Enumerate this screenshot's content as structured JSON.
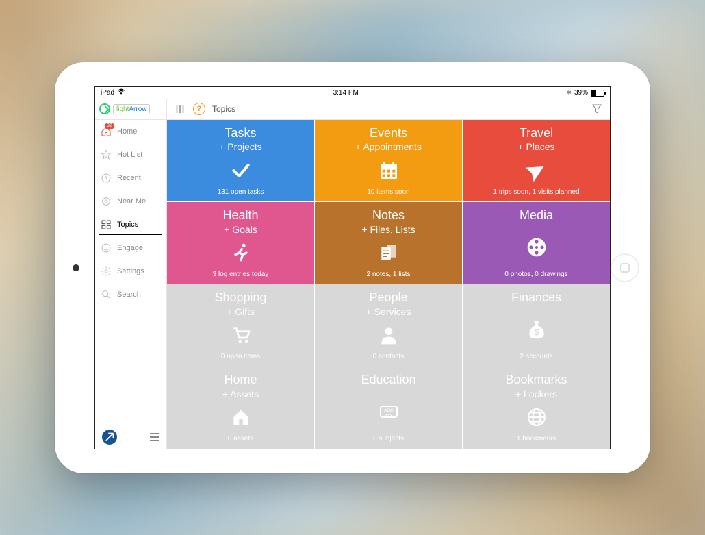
{
  "status": {
    "device": "iPad",
    "time": "3:14 PM",
    "battery_pct": "39%",
    "bluetooth": "*"
  },
  "brand": {
    "part1": "light",
    "part2": "Arrow"
  },
  "sidebar": {
    "home_badge": "92",
    "items": {
      "home": "Home",
      "hotlist": "Hot List",
      "recent": "Recent",
      "nearme": "Near Me",
      "topics": "Topics",
      "engage": "Engage",
      "settings": "Settings",
      "search": "Search"
    }
  },
  "toolbar": {
    "title": "Topics"
  },
  "tiles": {
    "tasks": {
      "title": "Tasks",
      "subtitle": "+ Projects",
      "status": "131 open tasks"
    },
    "events": {
      "title": "Events",
      "subtitle": "+ Appointments",
      "status": "10 items soon"
    },
    "travel": {
      "title": "Travel",
      "subtitle": "+ Places",
      "status": "1 trips soon, 1 visits planned"
    },
    "health": {
      "title": "Health",
      "subtitle": "+ Goals",
      "status": "3 log entries today"
    },
    "notes": {
      "title": "Notes",
      "subtitle": "+ Files, Lists",
      "status": "2 notes, 1 lists"
    },
    "media": {
      "title": "Media",
      "subtitle": "",
      "status": "0 photos, 0 drawings"
    },
    "shopping": {
      "title": "Shopping",
      "subtitle": "+ Gifts",
      "status": "0 open items"
    },
    "people": {
      "title": "People",
      "subtitle": "+ Services",
      "status": "0 contacts"
    },
    "finances": {
      "title": "Finances",
      "subtitle": "",
      "status": "2 accounts"
    },
    "home": {
      "title": "Home",
      "subtitle": "+ Assets",
      "status": "0 assets"
    },
    "education": {
      "title": "Education",
      "subtitle": "",
      "status": "0 subjects"
    },
    "bookmarks": {
      "title": "Bookmarks",
      "subtitle": "+ Lockers",
      "status": "1 bookmarks"
    }
  }
}
